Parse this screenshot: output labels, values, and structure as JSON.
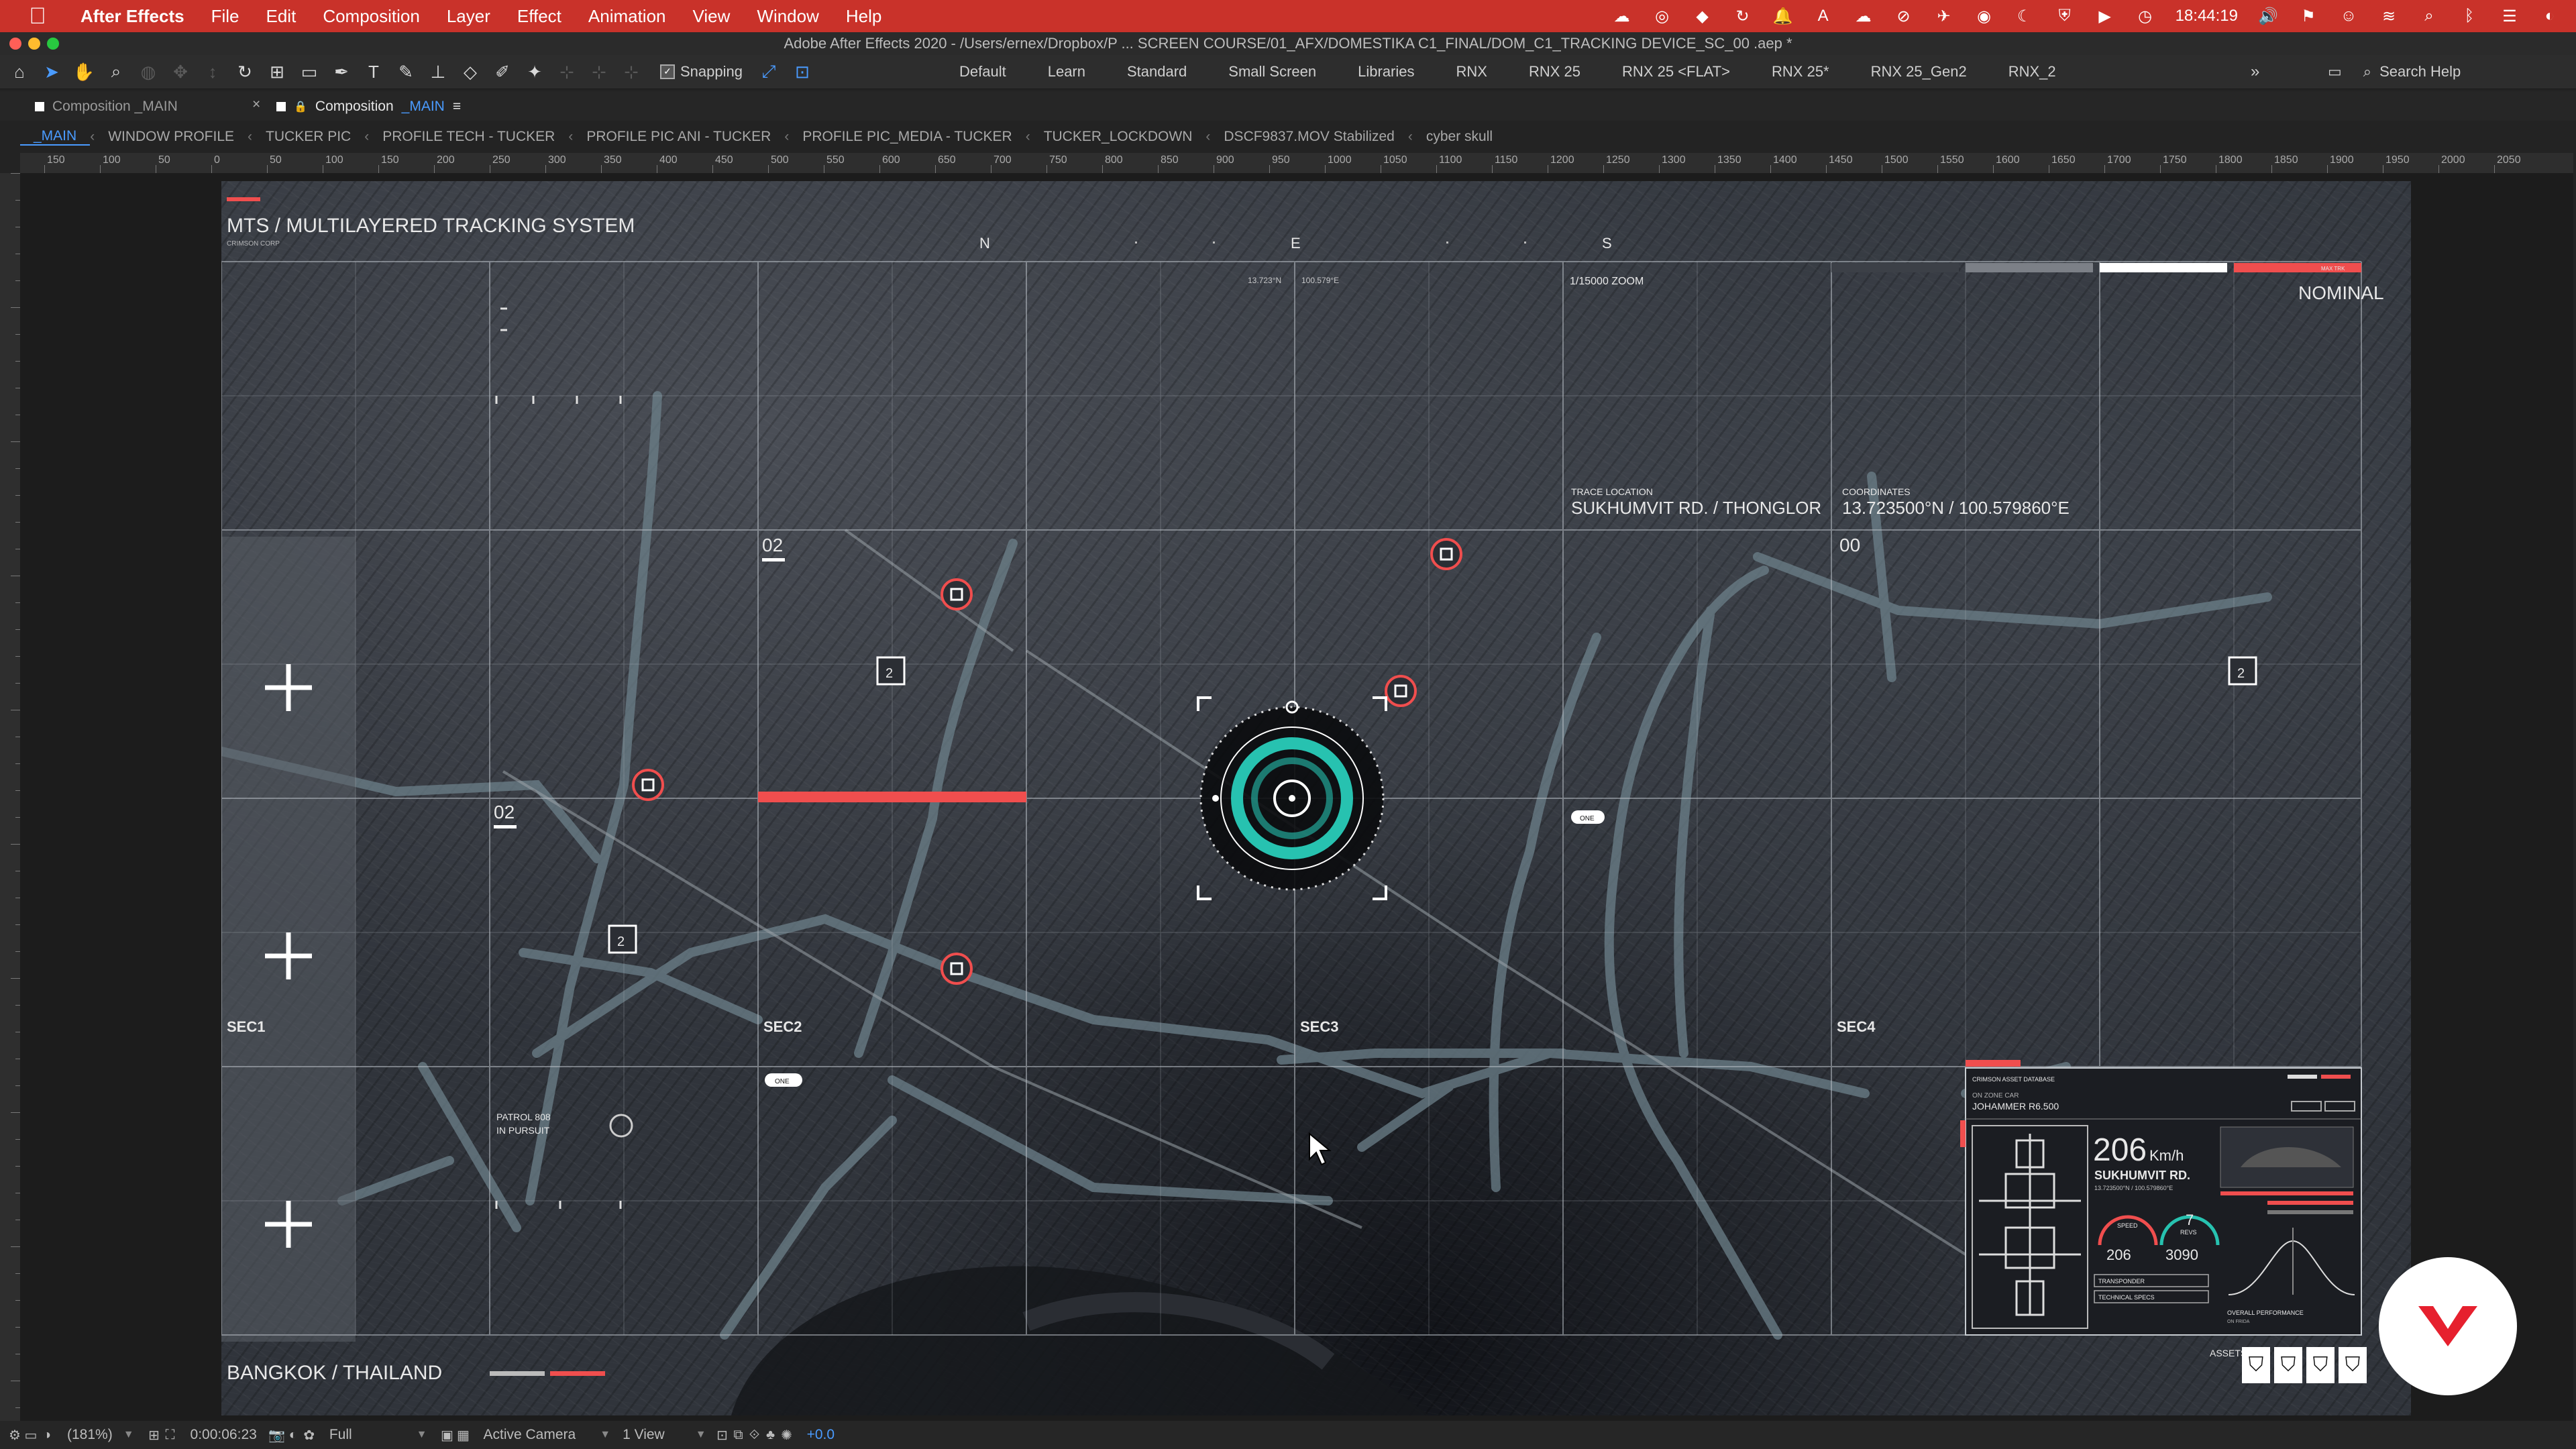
{
  "menubar": {
    "app": "After Effects",
    "items": [
      "File",
      "Edit",
      "Composition",
      "Layer",
      "Effect",
      "Animation",
      "View",
      "Window",
      "Help"
    ],
    "clock": "18:44:19"
  },
  "window": {
    "title": "Adobe After Effects 2020 - /Users/ernex/Dropbox/P ... SCREEN COURSE/01_AFX/DOMESTIKA C1_FINAL/DOM_C1_TRACKING DEVICE_SC_00 .aep *"
  },
  "toolbar": {
    "snapping_label": "Snapping",
    "workspaces": [
      "Default",
      "Learn",
      "Standard",
      "Small Screen",
      "Libraries",
      "RNX",
      "RNX 25",
      "RNX 25 <FLAT>",
      "RNX 25*",
      "RNX 25_Gen2",
      "RNX_2"
    ],
    "more": "»",
    "search_placeholder": "Search Help"
  },
  "panels": {
    "tab1": "Composition _MAIN",
    "tab2_prefix": "Composition",
    "tab2_name": "_MAIN",
    "tab2_menu": "≡",
    "close": "×"
  },
  "breadcrumbs": [
    "_MAIN",
    "WINDOW PROFILE",
    "TUCKER PIC",
    "PROFILE TECH - TUCKER",
    "PROFILE PIC ANI - TUCKER",
    "PROFILE PIC_MEDIA - TUCKER",
    "TUCKER_LOCKDOWN",
    "DSCF9837.MOV Stabilized",
    "cyber skull"
  ],
  "ruler": {
    "ticks": [
      "150",
      "100",
      "50",
      "0",
      "50",
      "100",
      "150",
      "200",
      "250",
      "300",
      "350",
      "400",
      "450",
      "500",
      "550",
      "600",
      "650",
      "700",
      "750",
      "800",
      "850",
      "900",
      "950",
      "1000",
      "1050",
      "1100",
      "1150",
      "1200",
      "1250",
      "1300",
      "1350",
      "1400",
      "1450",
      "1500",
      "1550",
      "1600",
      "1650",
      "1700",
      "1750",
      "1800",
      "1850",
      "1900",
      "1950",
      "2000",
      "2050"
    ]
  },
  "hud": {
    "title": "MTS / MULTILAYERED TRACKING SYSTEM",
    "subtitle": "CRIMSON CORP",
    "compass": [
      "N",
      "E",
      "S"
    ],
    "coords_small": [
      "13.723°N",
      "100.579°E"
    ],
    "zoom": "1/15000 ZOOM",
    "status": "NOMINAL",
    "status_tag": "MAX TRK",
    "trace_label": "TRACE LOCATION",
    "trace_value": "SUKHUMVIT RD. / THONGLOR",
    "coord_label": "COORDINATES",
    "coord_value": "13.723500°N / 100.579860°E",
    "grid_code": "00",
    "sectors": [
      "SEC1",
      "SEC2",
      "SEC3",
      "SEC4"
    ],
    "sector_codes": [
      "02",
      "02"
    ],
    "markers": [
      "2",
      "2",
      "2"
    ],
    "patrol": [
      "PATROL 808",
      "IN PURSUIT"
    ],
    "location": "BANGKOK / THAILAND",
    "tag_one": "ONE",
    "assets_label": "ASSETS",
    "panel": {
      "header": "CRIMSON ASSET DATABASE",
      "model_label": "ON ZONE CAR",
      "model": "JOHAMMER R6.500",
      "speed": "206",
      "speed_unit": "Km/h",
      "road": "SUKHUMVIT RD.",
      "road_coord": "13.723500°N / 100.579860°E",
      "gauge1_label": "SPEED",
      "gauge1_value": "206",
      "gauge2_label": "REVS",
      "gauge2_top": "7",
      "gauge2_value": "3090",
      "transponder": "TRANSPONDER",
      "tech_specs": "TECHNICAL SPECS",
      "overall": "OVERALL PERFORMANCE",
      "overall_sub": "ON FRIDA"
    }
  },
  "status": {
    "zoom": "(181%)",
    "timecode": "0:00:06:23",
    "resolution": "Full",
    "camera": "Active Camera",
    "views": "1 View",
    "exposure": "+0.0"
  },
  "colors": {
    "accent_red": "#f04e4e",
    "teal": "#27c2b0",
    "menubar": "#c9322a",
    "ae_blue": "#4a9bff"
  }
}
